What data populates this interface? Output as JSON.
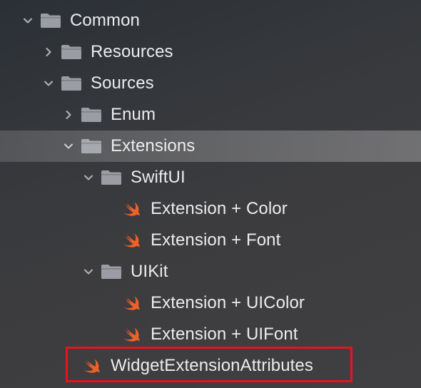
{
  "navigator": {
    "items": [
      {
        "label": "Common",
        "type": "folder",
        "expanded": true
      },
      {
        "label": "Resources",
        "type": "folder",
        "expanded": false
      },
      {
        "label": "Sources",
        "type": "folder",
        "expanded": true
      },
      {
        "label": "Enum",
        "type": "folder",
        "expanded": false
      },
      {
        "label": "Extensions",
        "type": "folder",
        "expanded": true,
        "selected": true
      },
      {
        "label": "SwiftUI",
        "type": "folder",
        "expanded": true
      },
      {
        "label": "Extension + Color",
        "type": "swift-file"
      },
      {
        "label": "Extension + Font",
        "type": "swift-file"
      },
      {
        "label": "UIKit",
        "type": "folder",
        "expanded": true
      },
      {
        "label": "Extension + UIColor",
        "type": "swift-file"
      },
      {
        "label": "Extension + UIFont",
        "type": "swift-file"
      },
      {
        "label": "WidgetExtensionAttributes",
        "type": "swift-file",
        "highlighted": true
      }
    ]
  },
  "icons": {
    "folder": "folder-icon",
    "swift_file": "swift-file-icon",
    "expanded": "chevron-down-icon",
    "collapsed": "chevron-right-icon"
  },
  "colors": {
    "selection_background": "#6e6e70",
    "folder_icon": "#9a9ea4",
    "swift_icon": "#f0612a",
    "text": "#ececec",
    "highlight_border": "#e8131b"
  }
}
